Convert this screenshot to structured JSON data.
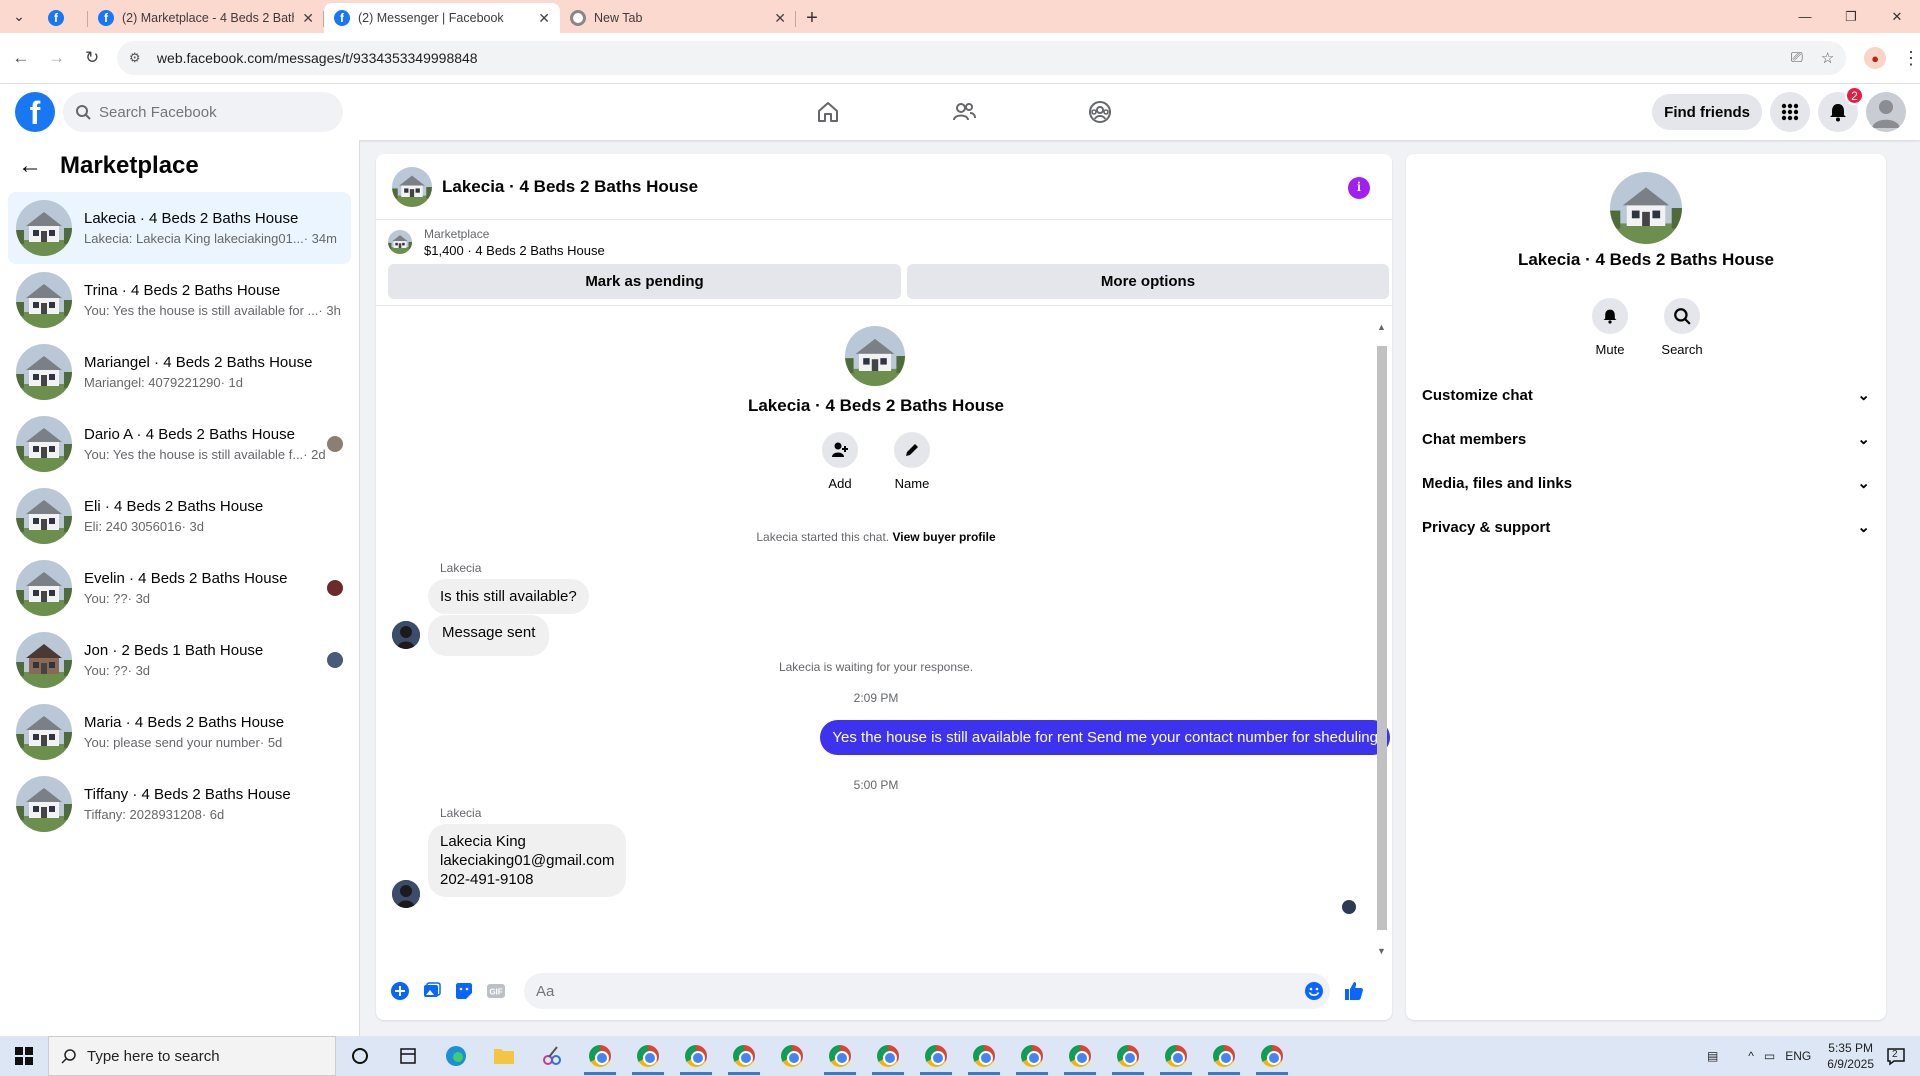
{
  "browser": {
    "tabs": [
      {
        "title": "",
        "icon": "facebook-icon"
      },
      {
        "title": "(2) Marketplace - 4 Beds 2 Bath",
        "icon": "facebook-icon"
      },
      {
        "title": "(2) Messenger | Facebook",
        "icon": "facebook-icon",
        "active": true
      },
      {
        "title": "New Tab",
        "icon": "chrome-icon"
      }
    ],
    "url": "web.facebook.com/messages/t/9334353349998848"
  },
  "header": {
    "search_placeholder": "Search Facebook",
    "find_friends": "Find friends",
    "notification_count": "2",
    "accent": "#1877f2"
  },
  "sidebar": {
    "title": "Marketplace",
    "conversations": [
      {
        "name": "Lakecia · 4 Beds 2 Baths House",
        "preview": "Lakecia: Lakecia King lakeciaking01...",
        "time": "· 34m",
        "selected": true
      },
      {
        "name": "Trina · 4 Beds 2 Baths House",
        "preview": "You: Yes the house is still available for ...",
        "time": "· 3h"
      },
      {
        "name": "Mariangel · 4 Beds 2 Baths House",
        "preview": "Mariangel: 4079221290",
        "time": "· 1d"
      },
      {
        "name": "Dario A · 4 Beds 2 Baths House",
        "preview": "You: Yes the house is still available f...",
        "time": "· 2d"
      },
      {
        "name": "Eli · 4 Beds 2 Baths House",
        "preview": "Eli: 240 3056016",
        "time": "· 3d"
      },
      {
        "name": "Evelin · 4 Beds 2 Baths House",
        "preview": "You: ??",
        "time": "· 3d"
      },
      {
        "name": "Jon · 2 Beds 1 Bath House",
        "preview": "You: ??",
        "time": "· 3d"
      },
      {
        "name": "Maria · 4 Beds 2 Baths House",
        "preview": "You: please send your number",
        "time": "· 5d"
      },
      {
        "name": "Tiffany · 4 Beds 2 Baths House",
        "preview": "Tiffany: 2028931208",
        "time": "· 6d"
      }
    ]
  },
  "chat": {
    "title": "Lakecia · 4 Beds 2 Baths House",
    "marketplace_label": "Marketplace",
    "listing": "$1,400 · 4 Beds 2 Baths House",
    "mark_pending": "Mark as pending",
    "more_options": "More options",
    "intro_name": "Lakecia · 4 Beds 2 Baths House",
    "add_label": "Add",
    "name_label": "Name",
    "started_text": "Lakecia started this chat.",
    "view_profile": "View buyer profile",
    "sender1": "Lakecia",
    "msg1": "Is this still available?",
    "msg2": "Message sent",
    "waiting_text": "Lakecia is waiting for your response.",
    "time1": "2:09 PM",
    "msg_out": "Yes the house is still available for rent Send me your contact number for sheduling",
    "time2": "5:00 PM",
    "sender2": "Lakecia",
    "msg3_line1": "Lakecia King",
    "msg3_line2": "lakeciaking01@gmail.com",
    "msg3_line3": "202-491-9108",
    "input_placeholder": "Aa",
    "outgoing_color": "#3d32ed"
  },
  "info": {
    "title": "Lakecia · 4 Beds 2 Baths House",
    "mute": "Mute",
    "search": "Search",
    "sections": [
      "Customize chat",
      "Chat members",
      "Media, files and links",
      "Privacy & support"
    ]
  },
  "taskbar": {
    "search_placeholder": "Type here to search",
    "time": "5:35 PM",
    "date": "6/9/2025",
    "lang": "ENG",
    "notif_count": "2"
  }
}
